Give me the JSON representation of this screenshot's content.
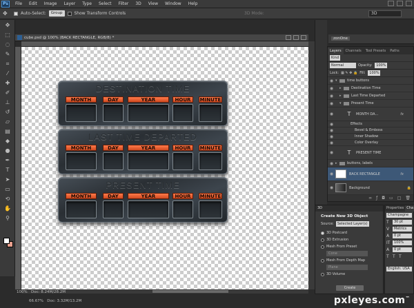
{
  "menu": [
    "File",
    "Edit",
    "Image",
    "Layer",
    "Type",
    "Select",
    "Filter",
    "3D",
    "View",
    "Window",
    "Help"
  ],
  "app_logo": "Ps",
  "options": {
    "auto_select_label": "Auto-Select:",
    "auto_select_value": "Group",
    "transform_label": "Show Transform Controls",
    "mode_3d": "3D Mode:",
    "workspace": "3D"
  },
  "document": {
    "title": "cube.psd @ 100% (BACK RECTANGLE, RGB/8) *",
    "status_zoom": "100%",
    "status_doc": "Doc: 8.24M/28.2M",
    "status_zoom_2": "66.67%",
    "status_doc_2": "Doc: 3.32M/13.2M"
  },
  "widgets": [
    {
      "title": "DESTINATION TIME",
      "labels": [
        "MONTH",
        "DAY",
        "YEAR",
        "HOUR",
        "MINUTE"
      ]
    },
    {
      "title": "LAST TIME DEPARTED",
      "labels": [
        "MONTH",
        "DAY",
        "YEAR",
        "HOUR",
        "MINUTE"
      ]
    },
    {
      "title": "PRESENT TIME",
      "labels": [
        "MONTH",
        "DAY",
        "YEAR",
        "HOUR",
        "MINUTE"
      ]
    }
  ],
  "mini_panel": {
    "tab": "zonOne"
  },
  "layers_panel": {
    "tabs": [
      "Layers",
      "Channels",
      "Tool Presets",
      "Paths"
    ],
    "kind": "Kind",
    "blend_mode": "Normal",
    "opacity_label": "Opacity:",
    "opacity": "100%",
    "lock_label": "Lock:",
    "fill_label": "Fill:",
    "fill": "100%",
    "layers": [
      {
        "name": "time buttons"
      },
      {
        "name": "Destination Time"
      },
      {
        "name": "Last Time Departed"
      },
      {
        "name": "Present Time"
      },
      {
        "name": "MONTH        DA..."
      },
      {
        "name": "Effects"
      },
      {
        "name": "Bevel & Emboss"
      },
      {
        "name": "Inner Shadow"
      },
      {
        "name": "Color Overlay"
      },
      {
        "name": "PRESENT TIME"
      },
      {
        "name": "buttons, labels"
      },
      {
        "name": "BACK RECTANGLE"
      },
      {
        "name": "Background"
      }
    ],
    "fx": "fx"
  },
  "panel_3d": {
    "tab": "3D",
    "title": "Create New 3D Object",
    "source_label": "Source:",
    "source_value": "Selected Layer(s)",
    "options": [
      "3D Postcard",
      "3D Extrusion",
      "Mesh From Preset",
      "Mesh From Depth Map",
      "3D Volume"
    ],
    "preset_value": "Cone",
    "depth_value": "Plane",
    "create_label": "Create"
  },
  "char_panel": {
    "tabs": [
      "Properties",
      "Cha"
    ],
    "font": "Champagne ...",
    "size": "30 pt",
    "kerning": "Metrics",
    "leading": "0 pt",
    "scale": "100%",
    "baseline": "0 pt",
    "language": "English: USA"
  },
  "watermark": "pxleyes.com"
}
